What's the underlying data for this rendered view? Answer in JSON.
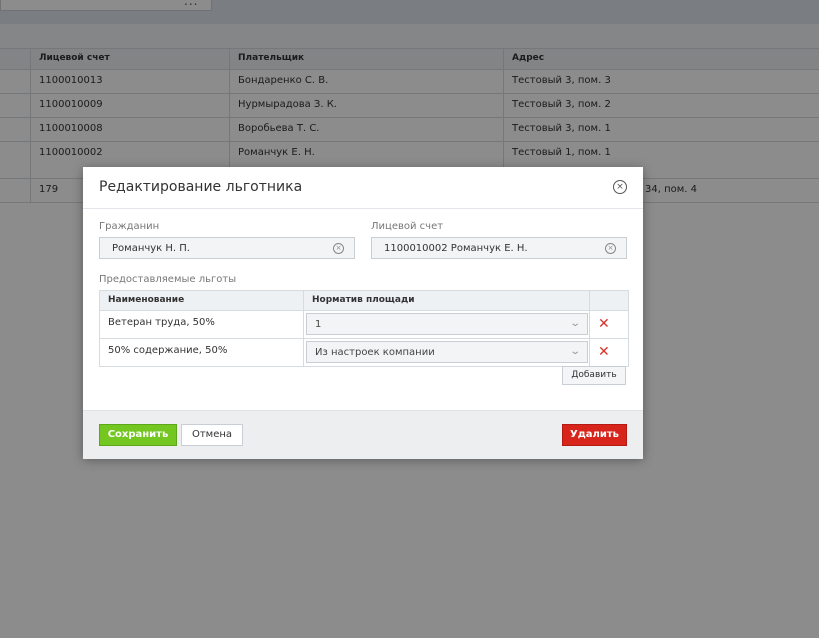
{
  "background": {
    "search_dots": "...",
    "columns": [
      "Лицевой счет",
      "Плательщик",
      "Адрес"
    ],
    "rows": [
      {
        "account": "1100010013",
        "payer": "Бондаренко С. В.",
        "address": "Тестовый 3, пом. 3"
      },
      {
        "account": "1100010009",
        "payer": "Нурмырадова З. К.",
        "address": "Тестовый 3, пом. 2"
      },
      {
        "account": "1100010008",
        "payer": "Воробьева Т. С.",
        "address": "Тестовый 3, пом. 1"
      },
      {
        "account": "1100010002",
        "payer": "Романчук Е. Н.",
        "address": "Тестовый 1, пом. 1"
      },
      {
        "account": "179",
        "payer": "",
        "address": "34, пом. 4"
      }
    ]
  },
  "dialog": {
    "title": "Редактирование льготника",
    "close_icon": "×",
    "citizen_label": "Гражданин",
    "citizen_value": "Романчук Н. П.",
    "account_label": "Лицевой счет",
    "account_value": "1100010002 Романчук Е. Н.",
    "benefits_label": "Предоставляемые льготы",
    "benefits_columns": [
      "Наименование",
      "Норматив площади"
    ],
    "benefits": [
      {
        "name": "Ветеран труда, 50%",
        "norm": "1"
      },
      {
        "name": "50% содержание, 50%",
        "norm": "Из настроек компании"
      }
    ],
    "delete_icon": "✕",
    "clear_icon": "×",
    "chevron": "⌄",
    "add_button": "Добавить",
    "save_button": "Сохранить",
    "cancel_button": "Отмена",
    "delete_button": "Удалить"
  },
  "colors": {
    "save": "#74c621",
    "delete": "#d7251c",
    "overlay": "rgba(0,0,0,0.45)"
  }
}
